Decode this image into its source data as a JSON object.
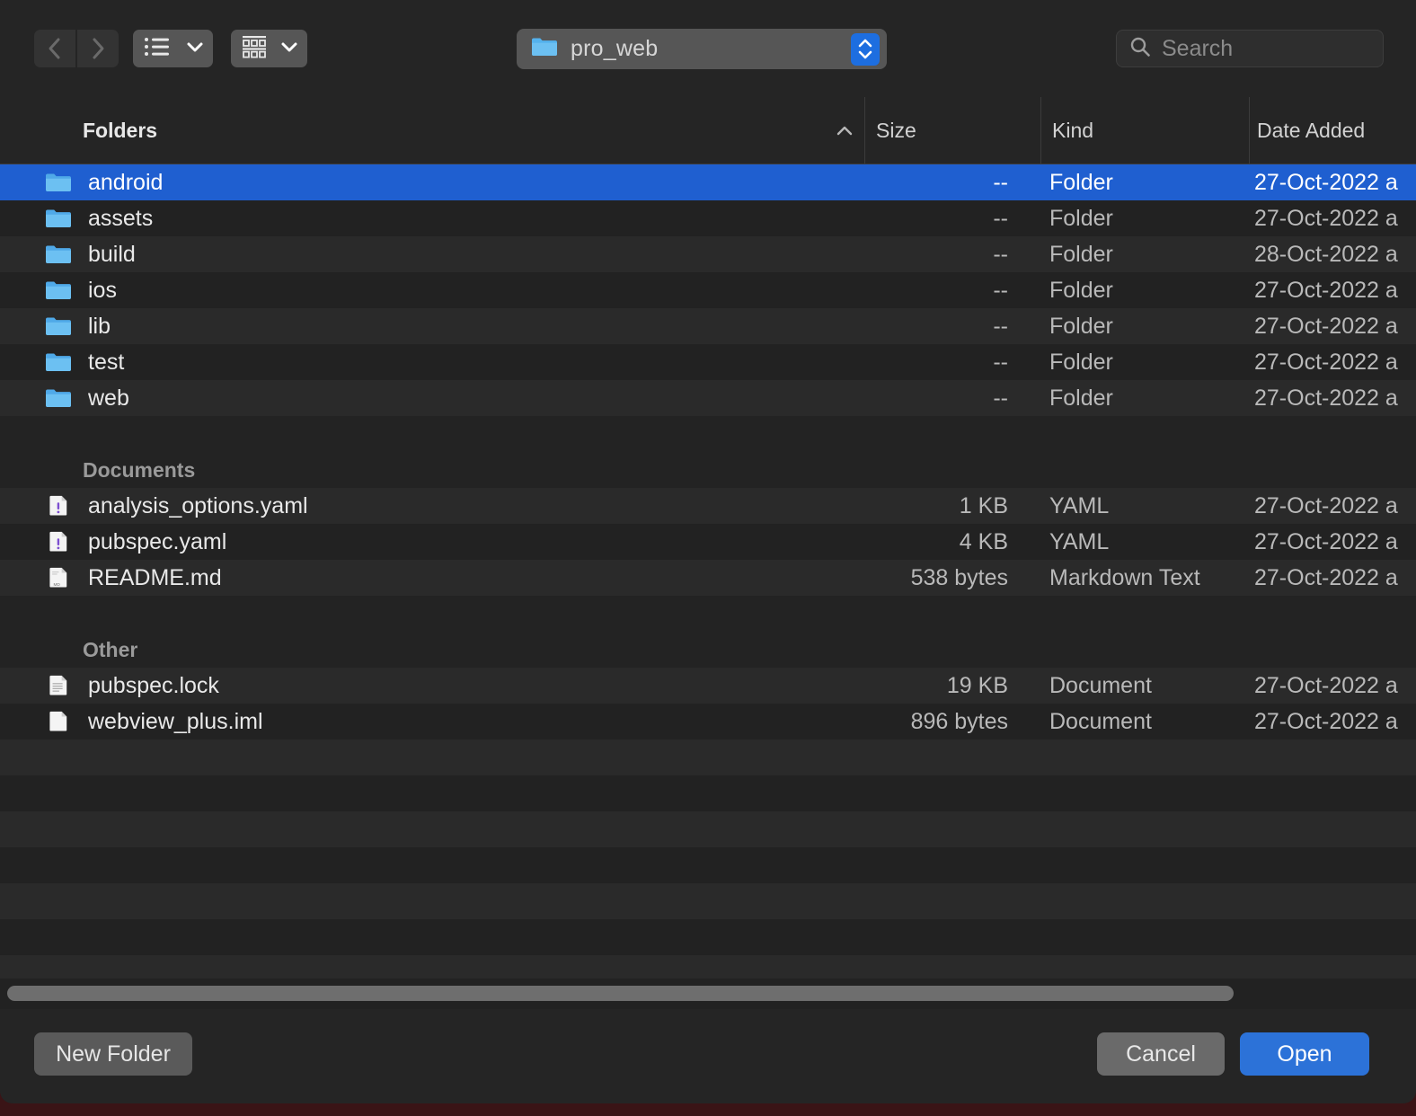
{
  "toolbar": {
    "back_icon": "chevron-left-icon",
    "forward_icon": "chevron-right-icon",
    "view_icon": "list-view-icon",
    "group_icon": "group-by-icon",
    "path_label": "pro_web",
    "path_icon": "folder-icon",
    "stepper_icon": "updown-stepper-icon",
    "search_placeholder": "Search",
    "search_value": "",
    "search_icon": "search-icon"
  },
  "columns": {
    "name": "Folders",
    "size": "Size",
    "kind": "Kind",
    "date": "Date Added",
    "sort_icon": "chevron-up-icon"
  },
  "sections": [
    {
      "title": "",
      "rows": [
        {
          "name": "android",
          "size": "--",
          "kind": "Folder",
          "date": "27-Oct-2022 a",
          "icon": "folder-icon",
          "selected": true
        },
        {
          "name": "assets",
          "size": "--",
          "kind": "Folder",
          "date": "27-Oct-2022 a",
          "icon": "folder-icon",
          "selected": false
        },
        {
          "name": "build",
          "size": "--",
          "kind": "Folder",
          "date": "28-Oct-2022 a",
          "icon": "folder-icon",
          "selected": false
        },
        {
          "name": "ios",
          "size": "--",
          "kind": "Folder",
          "date": "27-Oct-2022 a",
          "icon": "folder-icon",
          "selected": false
        },
        {
          "name": "lib",
          "size": "--",
          "kind": "Folder",
          "date": "27-Oct-2022 a",
          "icon": "folder-icon",
          "selected": false
        },
        {
          "name": "test",
          "size": "--",
          "kind": "Folder",
          "date": "27-Oct-2022 a",
          "icon": "folder-icon",
          "selected": false
        },
        {
          "name": "web",
          "size": "--",
          "kind": "Folder",
          "date": "27-Oct-2022 a",
          "icon": "folder-icon",
          "selected": false
        }
      ]
    },
    {
      "title": "Documents",
      "rows": [
        {
          "name": "analysis_options.yaml",
          "size": "1 KB",
          "kind": "YAML",
          "date": "27-Oct-2022 a",
          "icon": "yaml-file-icon",
          "selected": false
        },
        {
          "name": "pubspec.yaml",
          "size": "4 KB",
          "kind": "YAML",
          "date": "27-Oct-2022 a",
          "icon": "yaml-file-icon",
          "selected": false
        },
        {
          "name": "README.md",
          "size": "538 bytes",
          "kind": "Markdown Text",
          "date": "27-Oct-2022 a",
          "icon": "markdown-file-icon",
          "selected": false
        }
      ]
    },
    {
      "title": "Other",
      "rows": [
        {
          "name": "pubspec.lock",
          "size": "19 KB",
          "kind": "Document",
          "date": "27-Oct-2022 a",
          "icon": "text-file-icon",
          "selected": false
        },
        {
          "name": "webview_plus.iml",
          "size": "896 bytes",
          "kind": "Document",
          "date": "27-Oct-2022 a",
          "icon": "blank-file-icon",
          "selected": false
        }
      ]
    }
  ],
  "footer": {
    "new_folder": "New Folder",
    "cancel": "Cancel",
    "open": "Open"
  },
  "colors": {
    "selection_blue": "#1f5fd0",
    "accent_blue": "#2c72d8",
    "folder_blue": "#57b4ef",
    "window_bg": "#252525",
    "list_bg": "#232323",
    "row_alt": "#2a2a2a"
  }
}
